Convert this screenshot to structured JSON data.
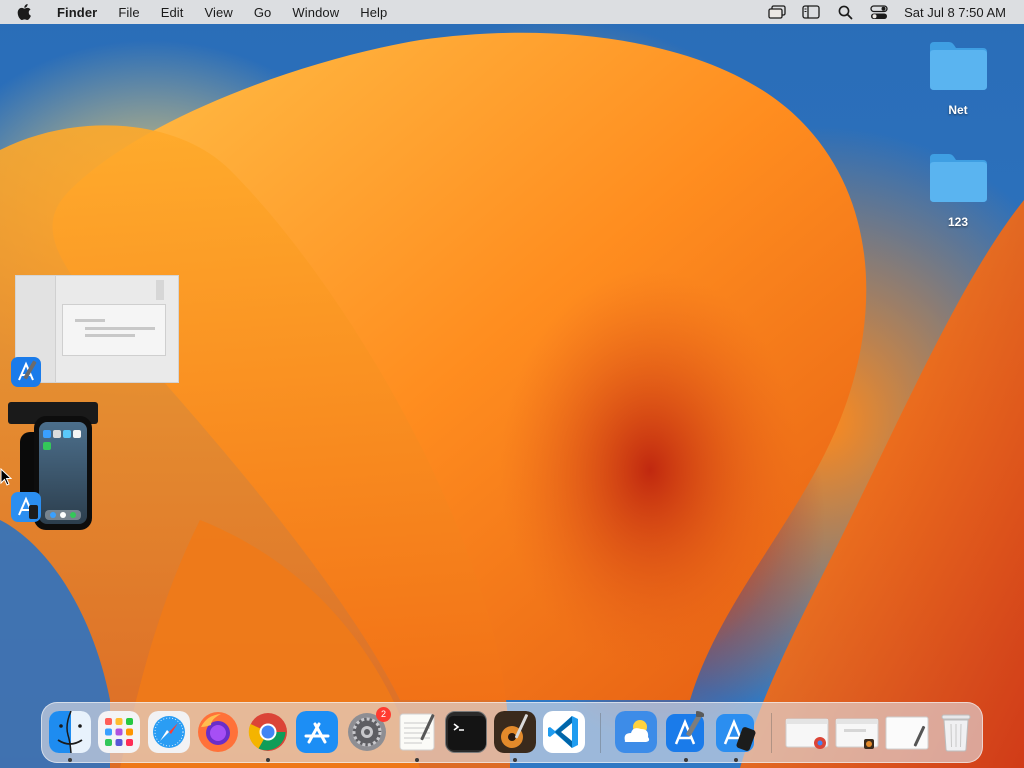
{
  "menubar": {
    "app_name": "Finder",
    "menus": [
      "File",
      "Edit",
      "View",
      "Go",
      "Window",
      "Help"
    ],
    "status_icons": [
      "screen-mirroring-icon",
      "sidebar-display-icon",
      "spotlight-search-icon",
      "control-center-icon"
    ],
    "clock": "Sat Jul 8  7:50 AM"
  },
  "desktop": {
    "folders": [
      {
        "label": "Net",
        "icon": "folder-icon",
        "color": "#5ab4f0"
      },
      {
        "label": "123",
        "icon": "folder-icon",
        "color": "#5ab4f0"
      }
    ],
    "window_thumbnails": [
      {
        "app": "Xcode",
        "icon": "xcode-icon"
      },
      {
        "app": "Simulator",
        "icon": "simulator-icon"
      }
    ]
  },
  "dock": {
    "apps": [
      {
        "name": "Finder",
        "icon": "finder-icon",
        "running": true
      },
      {
        "name": "Launchpad",
        "icon": "launchpad-icon",
        "running": false
      },
      {
        "name": "Safari",
        "icon": "safari-icon",
        "running": false
      },
      {
        "name": "Firefox",
        "icon": "firefox-icon",
        "running": false
      },
      {
        "name": "Google Chrome",
        "icon": "chrome-icon",
        "running": true
      },
      {
        "name": "App Store",
        "icon": "app-store-icon",
        "running": false
      },
      {
        "name": "System Settings",
        "icon": "system-settings-icon",
        "running": false,
        "badge": "2"
      },
      {
        "name": "TextEdit",
        "icon": "textedit-icon",
        "running": true
      },
      {
        "name": "Terminal",
        "icon": "terminal-icon",
        "running": false
      },
      {
        "name": "Instruments",
        "icon": "instruments-icon",
        "running": true
      },
      {
        "name": "Visual Studio Code",
        "icon": "vscode-icon",
        "running": false
      }
    ],
    "recent_apps": [
      {
        "name": "Weather",
        "icon": "weather-icon",
        "running": false
      },
      {
        "name": "Xcode",
        "icon": "xcode-icon",
        "running": true
      },
      {
        "name": "Simulator",
        "icon": "simulator-icon",
        "running": true
      }
    ],
    "minimized": [
      {
        "name": "Chrome window",
        "icon": "minimized-chrome-window-icon"
      },
      {
        "name": "Instruments window",
        "icon": "minimized-window-icon"
      },
      {
        "name": "TextEdit window",
        "icon": "minimized-document-icon"
      }
    ],
    "trash": {
      "name": "Trash",
      "icon": "trash-icon"
    }
  },
  "colors": {
    "menubar_bg": "#ece8e4",
    "accent_blue": "#2f78c4",
    "wallpaper_orange": "#ff8a1c",
    "badge_red": "#ff3b30"
  }
}
